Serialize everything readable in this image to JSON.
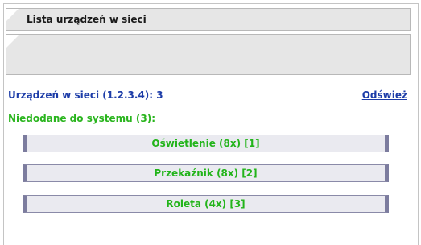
{
  "panel": {
    "title": "Lista urządzeń w sieci"
  },
  "network": {
    "count_label": "Urządzeń w sieci (1.2.3.4): 3",
    "refresh_label": "Odśwież"
  },
  "unadded": {
    "label": "Niedodane do systemu (3):",
    "devices": [
      {
        "label": "Oświetlenie (8x) [1]"
      },
      {
        "label": "Przekaźnik (8x) [2]"
      },
      {
        "label": "Roleta (4x) [3]"
      }
    ]
  },
  "colors": {
    "accent_blue": "#1c3ca8",
    "accent_green": "#2ab51e",
    "panel_grey": "#e6e6e6",
    "button_border": "#7c7c9e"
  }
}
